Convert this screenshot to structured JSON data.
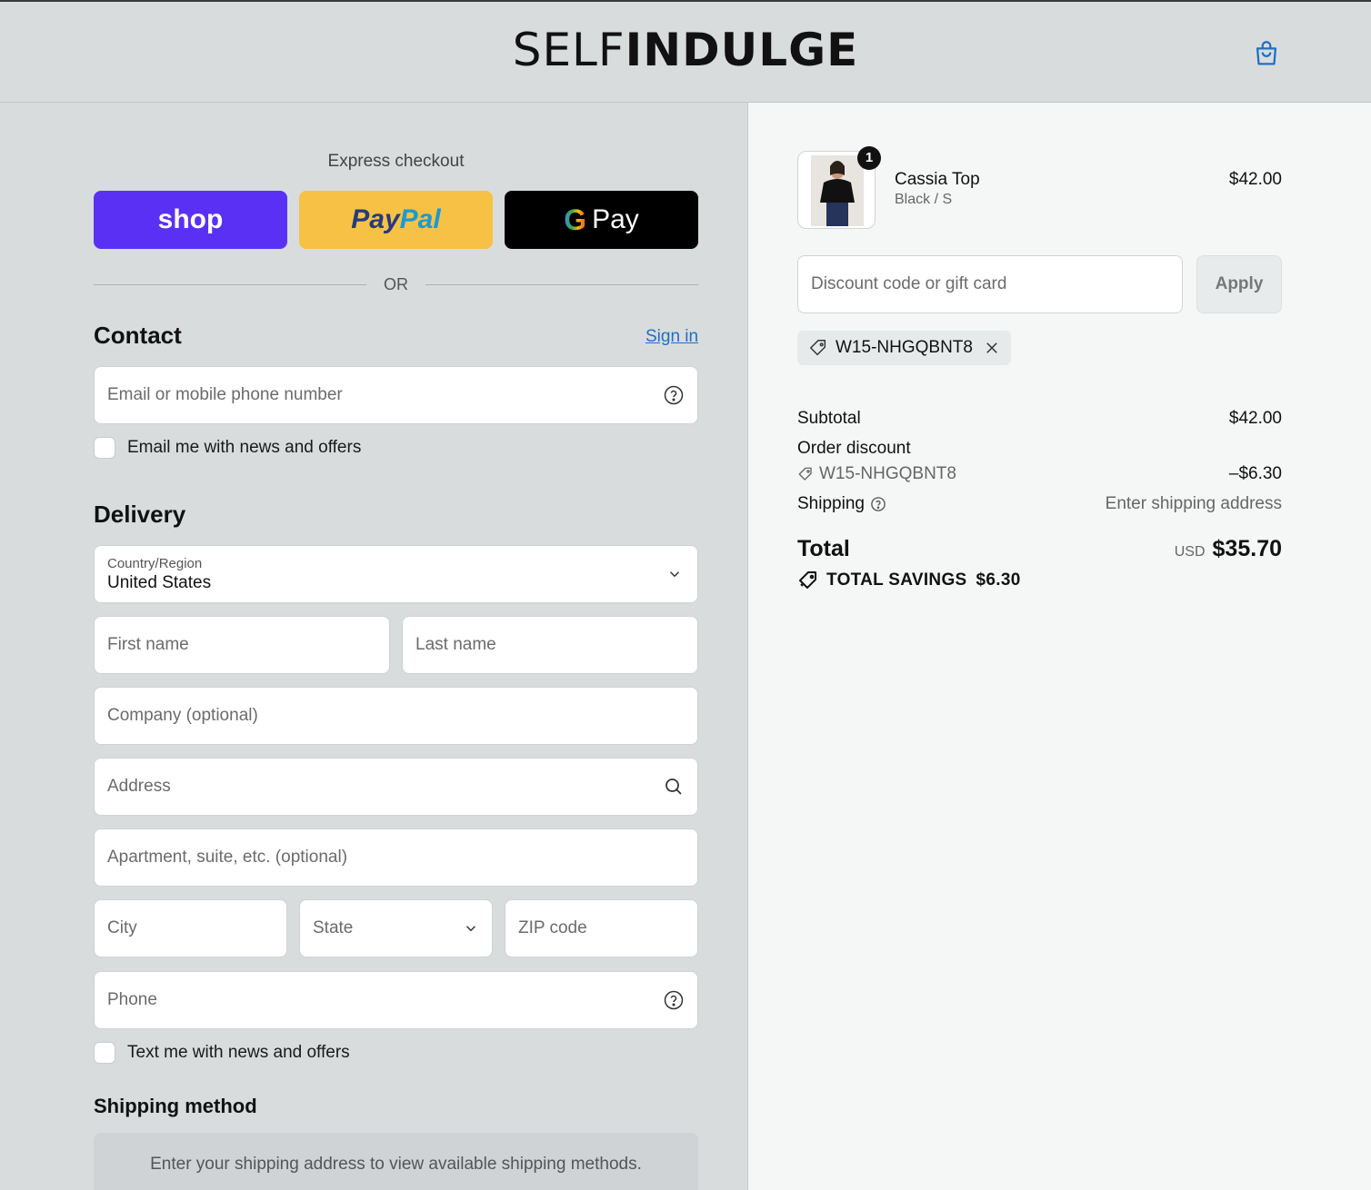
{
  "header": {
    "brand_thin": "SELF",
    "brand_bold": "INDULGE",
    "cart_icon": "shopping-bag-icon"
  },
  "express": {
    "title": "Express checkout",
    "shop_label": "shop",
    "paypal_part1": "Pay",
    "paypal_part2": "Pal",
    "gpay_g": "G",
    "gpay_label": "Pay",
    "or_label": "OR"
  },
  "contact": {
    "title": "Contact",
    "sign_in": "Sign in",
    "email_placeholder": "Email or mobile phone number",
    "email_opt_in": "Email me with news and offers"
  },
  "delivery": {
    "title": "Delivery",
    "country_label": "Country/Region",
    "country_value": "United States",
    "first_name": "First name",
    "last_name": "Last name",
    "company": "Company (optional)",
    "address": "Address",
    "apartment": "Apartment, suite, etc. (optional)",
    "city": "City",
    "state": "State",
    "zip": "ZIP code",
    "phone": "Phone",
    "sms_opt_in": "Text me with news and offers"
  },
  "shipping_method": {
    "title": "Shipping method",
    "message": "Enter your shipping address to view available shipping methods."
  },
  "summary": {
    "product": {
      "name": "Cassia Top",
      "variant": "Black / S",
      "price": "$42.00",
      "quantity": "1"
    },
    "discount_placeholder": "Discount code or gift card",
    "apply_label": "Apply",
    "applied_code": "W15-NHGQBNT8",
    "subtotal_label": "Subtotal",
    "subtotal_value": "$42.00",
    "order_discount_label": "Order discount",
    "order_discount_code": "W15-NHGQBNT8",
    "order_discount_value": "–$6.30",
    "shipping_label": "Shipping",
    "shipping_value": "Enter shipping address",
    "total_label": "Total",
    "currency": "USD",
    "total_value": "$35.70",
    "savings_label": "TOTAL SAVINGS",
    "savings_value": "$6.30"
  },
  "colors": {
    "shop_purple": "#5a31f4",
    "paypal_yellow": "#f6c145",
    "link_blue": "#1f6fc4",
    "panel_gray": "#d8dcdd"
  }
}
